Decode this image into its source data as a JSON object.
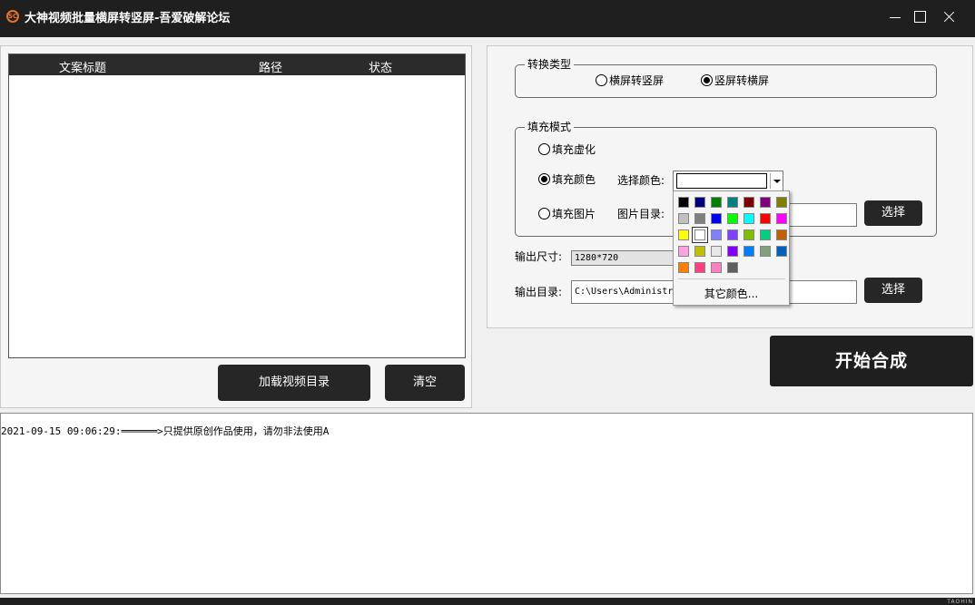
{
  "window": {
    "icon": "app-logo-icon",
    "title": "大神视频批量横屏转竖屏-吾爱破解论坛",
    "controls": [
      "minimize-icon",
      "maximize-icon",
      "close-icon"
    ]
  },
  "file_list": {
    "columns": [
      "文案标题",
      "路径",
      "状态"
    ],
    "rows": []
  },
  "left_buttons": {
    "load": "加载视频目录",
    "clear": "清空"
  },
  "convert_type": {
    "legend": "转换类型",
    "options": [
      {
        "label": "横屏转竖屏",
        "checked": false
      },
      {
        "label": "竖屏转横屏",
        "checked": true
      }
    ]
  },
  "fill_mode": {
    "legend": "填充模式",
    "options": [
      {
        "label": "填充虚化",
        "checked": false
      },
      {
        "label": "填充颜色",
        "checked": true
      },
      {
        "label": "填充图片",
        "checked": false
      }
    ],
    "color_label": "选择颜色:",
    "selected_color": "#FFFFFF",
    "image_dir_label": "图片目录:",
    "image_dir_value": "",
    "image_select": "选择"
  },
  "color_palette": {
    "colors": [
      [
        "#000000",
        "#000080",
        "#008000",
        "#008080",
        "#800000",
        "#800080",
        "#808000"
      ],
      [
        "#C0C0C0",
        "#808080",
        "#0000FF",
        "#00FF00",
        "#00FFFF",
        "#FF0000",
        "#FF00FF"
      ],
      [
        "#FFFF00",
        "#FFFFFF",
        "#8080FF",
        "#8040FF",
        "#80C000",
        "#00D080",
        "#C06000"
      ],
      [
        "#FFA0E0",
        "#C0C000",
        "#E8E8E8",
        "#8000FF",
        "#0080FF",
        "#80A080",
        "#0060C0"
      ],
      [
        "#FF8000",
        "#FF4080",
        "#FF80C0",
        "#606060"
      ]
    ],
    "more_colors": "其它颜色..."
  },
  "output": {
    "size_label": "输出尺寸:",
    "size_value": "1280*720",
    "dir_label": "输出目录:",
    "dir_value": "C:\\Users\\Administr",
    "dir_select": "选择"
  },
  "start_button": "开始合成",
  "log": [
    "2021-09-15 09:06:29:══════>只提供原创作品使用，请勿非法使用A"
  ],
  "watermark": "TAOHIN"
}
